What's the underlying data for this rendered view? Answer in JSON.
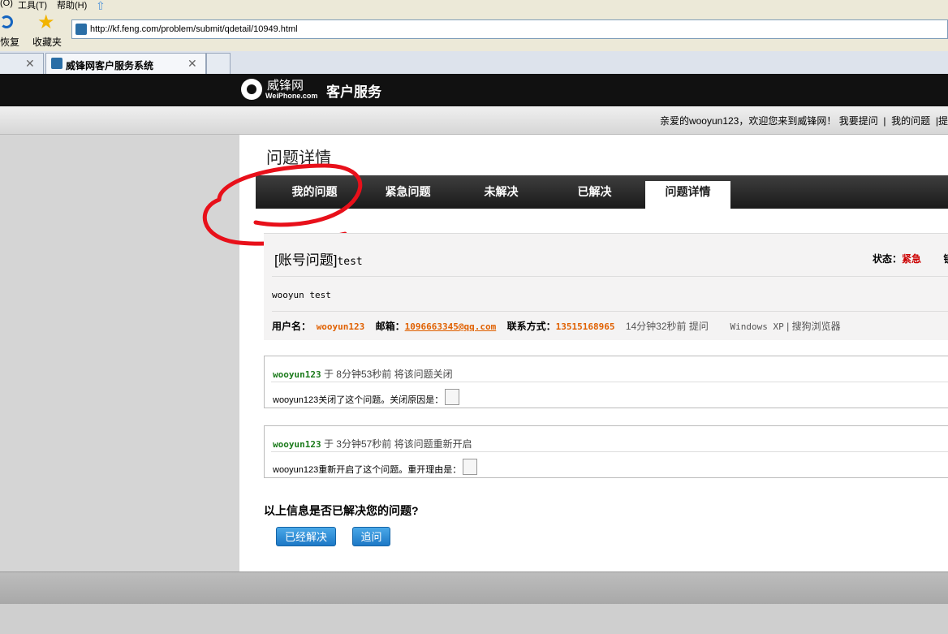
{
  "browser": {
    "menu": [
      "(O)",
      "工具(T)",
      "帮助(H)"
    ],
    "toolbar": {
      "restore_label": "恢复",
      "favorites_label": "收藏夹"
    },
    "address": "http://kf.feng.com/problem/submit/qdetail/10949.html",
    "tabs": [
      {
        "title": "",
        "close": "✕"
      },
      {
        "title": "威锋网客户服务系统",
        "close": "✕"
      },
      {
        "title": ""
      }
    ]
  },
  "header": {
    "logo_cn": "威锋网",
    "logo_en": "WeiPhone.com",
    "service": "客户服务"
  },
  "welcome": {
    "greeting": "亲爱的wooyun123，欢迎您来到威锋网！",
    "links": [
      "我要提问",
      "我的问题",
      "提"
    ],
    "sep": "|"
  },
  "page": {
    "title": "问题详情",
    "nav": [
      "我的问题",
      "紧急问题",
      "未解决",
      "已解决",
      "问题详情"
    ],
    "active_nav": "问题详情"
  },
  "question": {
    "category": "[账号问题]",
    "subject": "test",
    "status_label": "状态：",
    "status_value": "紧急",
    "status_more": "锁",
    "body": "wooyun test",
    "user_label": "用户名：",
    "user_value": "wooyun123",
    "email_label": "邮箱：",
    "email_value": "1096663345@qq.com",
    "contact_label": "联系方式：",
    "contact_value": "13515168965",
    "time": "14分钟32秒前 提问",
    "os": "Windows XP",
    "browser_sep": "|",
    "browser": "搜狗浏览器"
  },
  "comments": [
    {
      "user": "wooyun123",
      "action": "于 8分钟53秒前 将该问题关闭",
      "body": "wooyun123关闭了这个问题。关闭原因是："
    },
    {
      "user": "wooyun123",
      "action": "于 3分钟57秒前 将该问题重新开启",
      "body": "wooyun123重新开启了这个问题。重开理由是："
    }
  ],
  "feedback": {
    "question": "以上信息是否已解决您的问题?",
    "resolved_button": "已经解决",
    "followup_button": "追问"
  },
  "colors": {
    "accent": "#1d78c6",
    "urgent": "#cc0000",
    "orange": "#e06000",
    "annotation": "#e8101a"
  }
}
